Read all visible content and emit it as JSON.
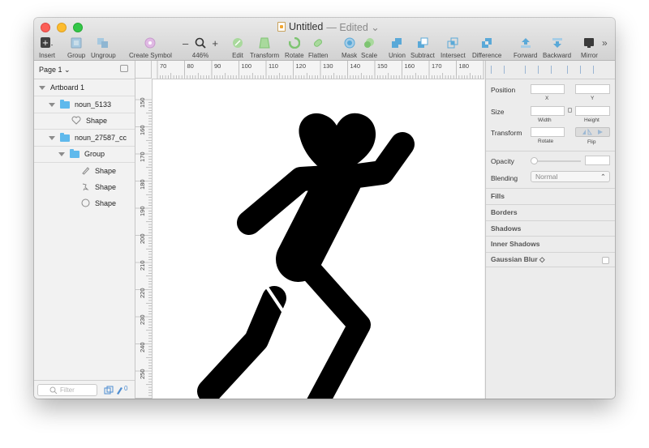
{
  "window": {
    "title": "Untitled",
    "title_status": "— Edited ⌄"
  },
  "toolbar": {
    "insert": "Insert",
    "group": "Group",
    "ungroup": "Ungroup",
    "create_symbol": "Create Symbol",
    "zoom_minus": "–",
    "zoom_plus": "+",
    "zoom_level": "446%",
    "edit": "Edit",
    "transform": "Transform",
    "rotate": "Rotate",
    "flatten": "Flatten",
    "mask": "Mask",
    "scale": "Scale",
    "union": "Union",
    "subtract": "Subtract",
    "intersect": "Intersect",
    "difference": "Difference",
    "forward": "Forward",
    "backward": "Backward",
    "mirror": "Mirror",
    "overflow": "»"
  },
  "sidebar": {
    "page_selector": "Page 1 ⌄",
    "layers": [
      {
        "label": "Artboard 1"
      },
      {
        "label": "noun_5133"
      },
      {
        "label": "Shape"
      },
      {
        "label": "noun_27587_cc"
      },
      {
        "label": "Group"
      },
      {
        "label": "Shape"
      },
      {
        "label": "Shape"
      },
      {
        "label": "Shape"
      }
    ],
    "filter_placeholder": "Filter",
    "filter_count": "0"
  },
  "rulers": {
    "horizontal": [
      "70",
      "80",
      "90",
      "100",
      "110",
      "120",
      "130",
      "140",
      "150",
      "160",
      "170",
      "180"
    ],
    "vertical": [
      "150",
      "160",
      "170",
      "180",
      "190",
      "200",
      "210",
      "220",
      "230",
      "240",
      "250"
    ]
  },
  "inspector": {
    "position_label": "Position",
    "x_label": "X",
    "y_label": "Y",
    "size_label": "Size",
    "width_label": "Width",
    "height_label": "Height",
    "transform_label": "Transform",
    "rotate_label": "Rotate",
    "flip_label": "Flip",
    "opacity_label": "Opacity",
    "blending_label": "Blending",
    "blending_value": "Normal",
    "fills": "Fills",
    "borders": "Borders",
    "shadows": "Shadows",
    "inner_shadows": "Inner Shadows",
    "gaussian_blur": "Gaussian Blur ◇"
  },
  "colors": {
    "toolbar_icon_green": "#7ec472",
    "toolbar_icon_blue": "#5aa9d8",
    "folder_blue": "#5fb9ec",
    "figure": "#000000"
  }
}
